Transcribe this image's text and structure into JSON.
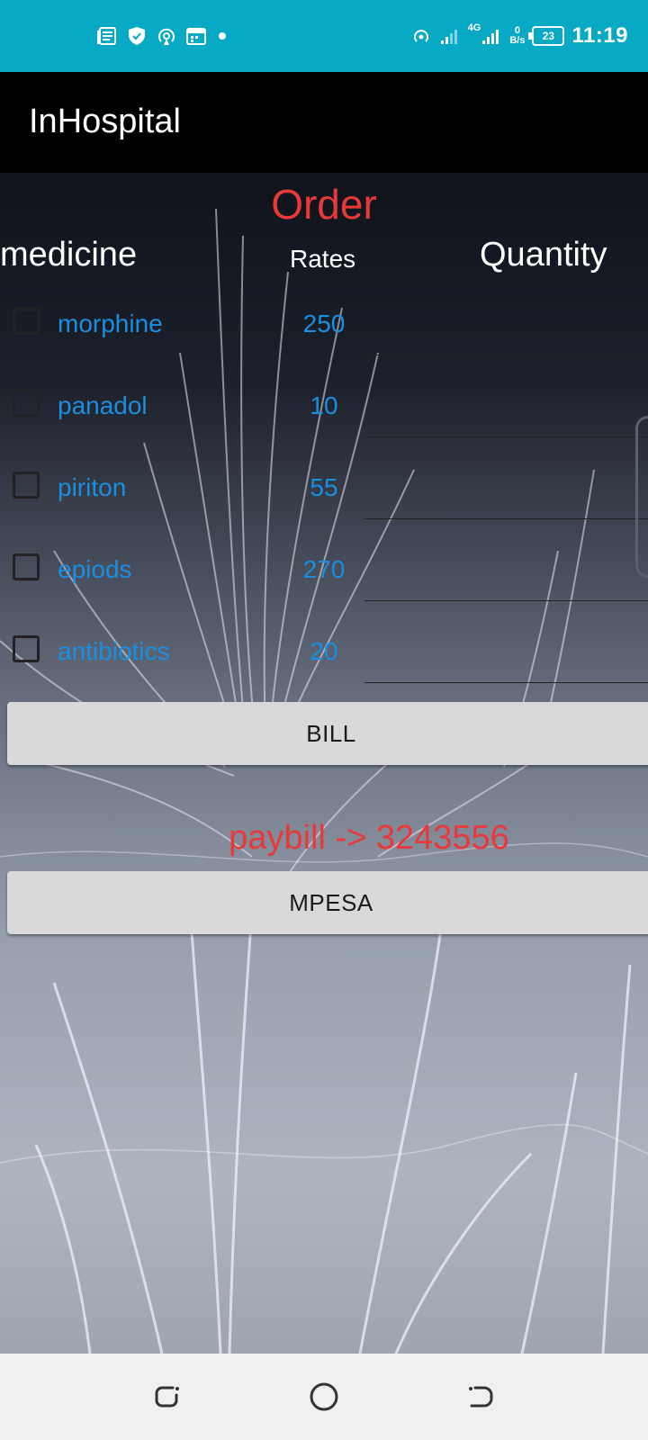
{
  "status_bar": {
    "time": "11:19",
    "network": "4G",
    "speed_value": "0",
    "speed_unit": "B/s",
    "battery": "23"
  },
  "app_bar": {
    "title": "InHospital"
  },
  "order": {
    "title": "Order",
    "headers": {
      "medicine": "medicine",
      "rates": "Rates",
      "quantity": "Quantity"
    },
    "items": [
      {
        "name": "morphine",
        "rate": "250",
        "quantity": ""
      },
      {
        "name": "panadol",
        "rate": "10",
        "quantity": ""
      },
      {
        "name": "piriton",
        "rate": "55",
        "quantity": ""
      },
      {
        "name": "epiods",
        "rate": "270",
        "quantity": ""
      },
      {
        "name": "antibiotics",
        "rate": "20",
        "quantity": ""
      }
    ],
    "bill_label": "BILL",
    "paybill_text": "paybill -> 3243556",
    "mpesa_label": "MPESA"
  },
  "colors": {
    "status_bar": "#07a9c4",
    "accent_red": "#e8393a",
    "link_blue": "#1a8fe0",
    "button": "#d9d9d9"
  }
}
